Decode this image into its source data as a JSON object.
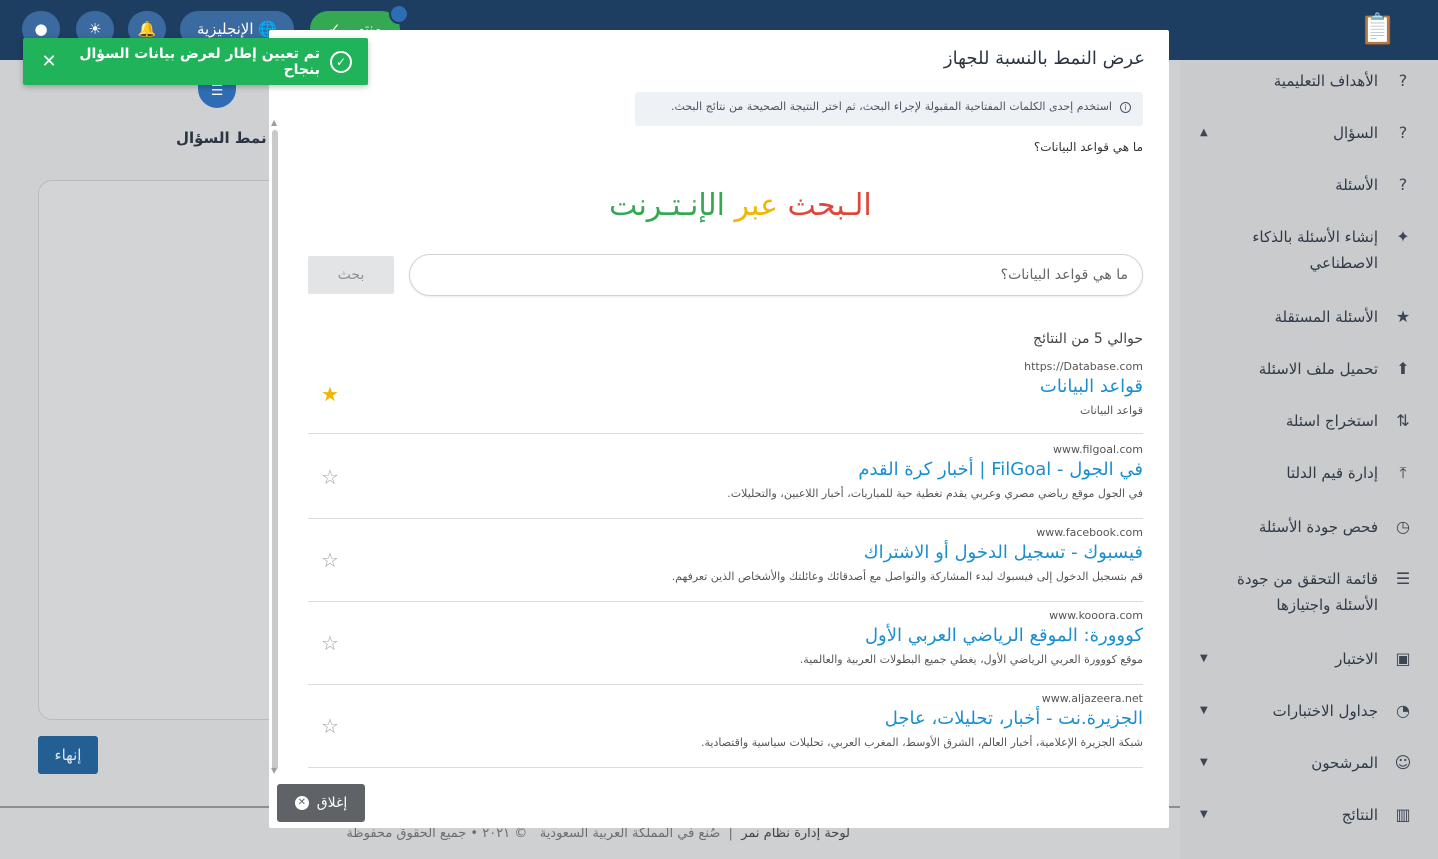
{
  "app": {
    "top": {
      "finish_top": "✓ منتهي",
      "lang": "الإنجليزية"
    },
    "step_label": "نمط السؤال",
    "finish_label": "إنهاء",
    "footer": {
      "brand": "لوحة إدارة نظام نمر",
      "made_in": "صُنع في المملكة العربية السعودية",
      "rights": "© ٢٠٢١ • جميع الحقوق محفوظة"
    },
    "sidebar": [
      {
        "label": "الأهداف التعليمية",
        "icon": "help-box-icon"
      },
      {
        "label": "السؤال",
        "icon": "question-square-icon",
        "arrow": "up"
      },
      {
        "label": "الأسئلة",
        "icon": "questions-stack-icon"
      },
      {
        "label": "إنشاء الأسئلة بالذكاء الاصطناعي",
        "icon": "sparkle-icon"
      },
      {
        "label": "الأسئلة المستقلة",
        "icon": "star-icon"
      },
      {
        "label": "تحميل ملف الاسئلة",
        "icon": "file-upload-icon"
      },
      {
        "label": "استخراج اسئلة",
        "icon": "swap-vertical-icon"
      },
      {
        "label": "إدارة قيم الدلتا",
        "icon": "upload-icon"
      },
      {
        "label": "فحص جودة الأسئلة",
        "icon": "clipboard-clock-icon"
      },
      {
        "label": "قائمة التحقق من جودة الأسئلة واجتيازها",
        "icon": "checklist-icon"
      },
      {
        "label": "الاختبار",
        "icon": "scan-icon",
        "arrow": "down"
      },
      {
        "label": "جداول الاختبارات",
        "icon": "clock-icon",
        "arrow": "down"
      },
      {
        "label": "المرشحون",
        "icon": "users-icon",
        "arrow": "down"
      },
      {
        "label": "النتائج",
        "icon": "bar-chart-icon",
        "arrow": "down"
      }
    ]
  },
  "toast": {
    "message": "تم تعيين إطار لعرض بيانات السؤال بنجاح",
    "color": "#21b359"
  },
  "modal": {
    "title": "عرض النمط بالنسبة للجهاز",
    "info": "استخدم إحدى الكلمات المفتاحية المقبولة لإجراء البحث، ثم اختر النتيجة الصحيحة من نتائج البحث.",
    "question": "ما هي قواعد البيانات؟",
    "brand_parts": [
      {
        "text": "الـبحث",
        "color": "#e0453a"
      },
      {
        "text": " عبر ",
        "color": "#f2b600"
      },
      {
        "text": "الإنـتـرنت",
        "color": "#34a853"
      }
    ],
    "search": {
      "value": "ما هي قواعد البيانات؟",
      "button": "بحث"
    },
    "results_count": "حوالي 5 من النتائج",
    "results": [
      {
        "url": "https://Database.com",
        "title": "قواعد البيانات",
        "desc": "قواعد البيانات",
        "starred": true
      },
      {
        "url": "www.filgoal.com",
        "title": "في الجول - FilGoal | أخبار كرة القدم",
        "desc": "في الجول موقع رياضي مصري وعربي يقدم تغطية حية للمباريات، أخبار اللاعبين، والتحليلات.",
        "starred": false
      },
      {
        "url": "www.facebook.com",
        "title": "فيسبوك - تسجيل الدخول أو الاشتراك",
        "desc": "قم بتسجيل الدخول إلى فيسبوك لبدء المشاركة والتواصل مع أصدقائك وعائلتك والأشخاص الذين تعرفهم.",
        "starred": false
      },
      {
        "url": "www.kooora.com",
        "title": "كووورة: الموقع الرياضي العربي الأول",
        "desc": "موقع كووورة العربي الرياضي الأول، يغطي جميع البطولات العربية والعالمية.",
        "starred": false
      },
      {
        "url": "www.aljazeera.net",
        "title": "الجزيرة.نت - أخبار، تحليلات، عاجل",
        "desc": "شبكة الجزيرة الإعلامية، أخبار العالم، الشرق الأوسط، المغرب العربي، تحليلات سياسية واقتصادية.",
        "starred": false
      }
    ],
    "close_label": "إغلاق"
  }
}
